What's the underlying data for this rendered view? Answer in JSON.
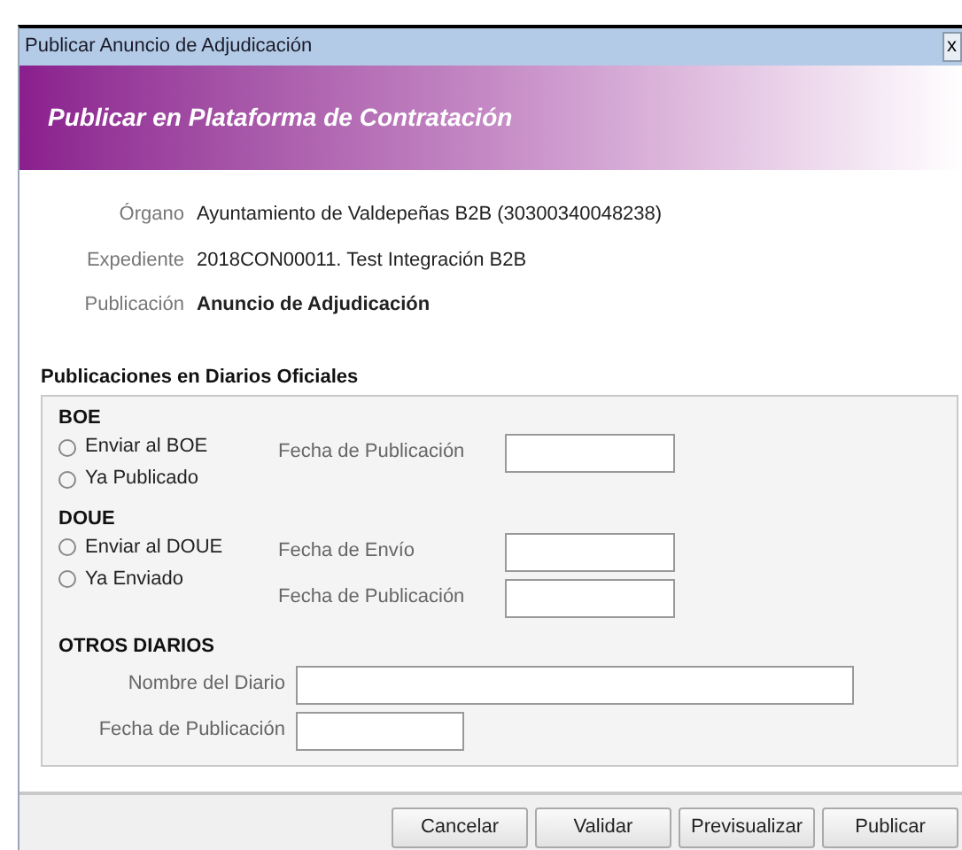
{
  "window": {
    "title": "Publicar Anuncio de Adjudicación",
    "close": "x"
  },
  "banner": {
    "title": "Publicar en Plataforma de Contratación"
  },
  "details": [
    {
      "label": "Órgano",
      "value": "Ayuntamiento de Valdepeñas B2B (30300340048238)",
      "bold": false
    },
    {
      "label": "Expediente",
      "value": "2018CON00011. Test Integración B2B",
      "bold": false
    },
    {
      "label": "Publicación",
      "value": "Anuncio de Adjudicación",
      "bold": true
    }
  ],
  "section": {
    "title": "Publicaciones en Diarios Oficiales"
  },
  "groups": [
    {
      "title": "BOE",
      "options": [
        {
          "label": "Enviar al BOE",
          "selected": false
        },
        {
          "label": "Ya Publicado",
          "selected": false
        }
      ],
      "fields": [
        {
          "label": "Fecha de Publicación"
        }
      ]
    },
    {
      "title": "DOUE",
      "options": [
        {
          "label": "Enviar al DOUE",
          "selected": false
        },
        {
          "label": "Ya Enviado",
          "selected": false
        }
      ],
      "fields": [
        {
          "label": "Fecha de Envío"
        },
        {
          "label": "Fecha de Publicación"
        }
      ]
    }
  ],
  "otros": {
    "title": "OTROS DIARIOS",
    "fields": [
      {
        "label": "Nombre del Diario",
        "kind": "wide"
      },
      {
        "label": "Fecha de Publicación",
        "kind": "short"
      }
    ]
  },
  "buttons": [
    "Cancelar",
    "Validar",
    "Previsualizar",
    "Publicar"
  ]
}
